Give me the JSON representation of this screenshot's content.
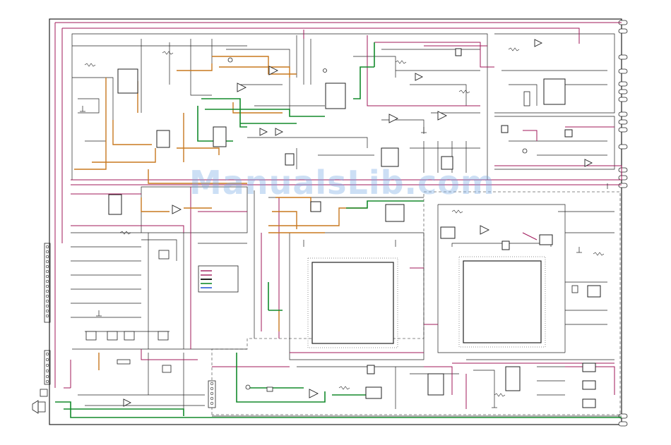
{
  "watermark": {
    "text": "ManualsLib.com"
  },
  "colors": {
    "background": "#ffffff",
    "line": "#222222",
    "magenta": "#a0185a",
    "orange": "#c8781e",
    "green": "#138a2c",
    "blue": "#2a5bd7",
    "watermark": "#8ab4e8"
  },
  "legend": {
    "swatch_colors": [
      "#a0185a",
      "#a0185a",
      "#222222",
      "#138a2c",
      "#2a5bd7"
    ]
  }
}
